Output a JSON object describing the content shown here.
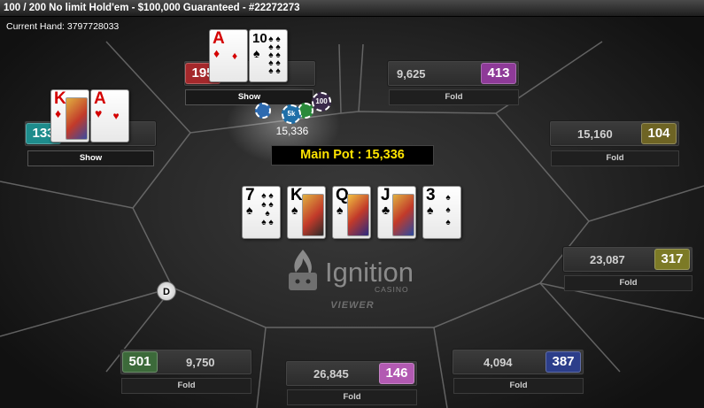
{
  "window_title": "100 / 200 No limit Hold'em - $100,000 Guaranteed - #22272273",
  "current_hand": "Current Hand: 3797728033",
  "main_pot_label": "Main Pot : 15,336",
  "pot_chips_amount": "15,336",
  "chip_labels": [
    "5k",
    "100"
  ],
  "dealer_label": "D",
  "logo": {
    "name": "Ignition",
    "sub": "CASINO",
    "viewer": "VIEWER"
  },
  "board": [
    {
      "rank": "7",
      "suit": "♠",
      "color": "black"
    },
    {
      "rank": "K",
      "suit": "♠",
      "color": "black"
    },
    {
      "rank": "Q",
      "suit": "♠",
      "color": "black"
    },
    {
      "rank": "J",
      "suit": "♣",
      "color": "black"
    },
    {
      "rank": "3",
      "suit": "♠",
      "color": "black"
    }
  ],
  "seats": {
    "top_left": {
      "badge": "195",
      "badge_color": "#a4282b",
      "stack": "",
      "status": "Show",
      "cards": [
        {
          "rank": "A",
          "suit": "♦",
          "color": "red"
        },
        {
          "rank": "10",
          "suit": "♠",
          "color": "black"
        }
      ]
    },
    "left": {
      "badge": "133",
      "badge_color": "#1e8c8c",
      "stack": "",
      "status": "Show",
      "cards": [
        {
          "rank": "K",
          "suit": "♦",
          "color": "red"
        },
        {
          "rank": "A",
          "suit": "♥",
          "color": "red"
        }
      ]
    },
    "top_right": {
      "badge": "413",
      "badge_color": "#8e3a98",
      "stack": "9,625",
      "status": "Fold"
    },
    "right_upper": {
      "badge": "104",
      "badge_color": "#6e6424",
      "stack": "15,160",
      "status": "Fold"
    },
    "right_lower": {
      "badge": "317",
      "badge_color": "#7c7a26",
      "stack": "23,087",
      "status": "Fold"
    },
    "bottom_right": {
      "badge": "387",
      "badge_color": "#2c3e8a",
      "stack": "4,094",
      "status": "Fold"
    },
    "bottom_center": {
      "badge": "146",
      "badge_color": "#b25ab2",
      "stack": "26,845",
      "status": "Fold"
    },
    "bottom_left": {
      "badge": "501",
      "badge_color": "#3c6a3a",
      "stack": "9,750",
      "status": "Fold"
    }
  }
}
